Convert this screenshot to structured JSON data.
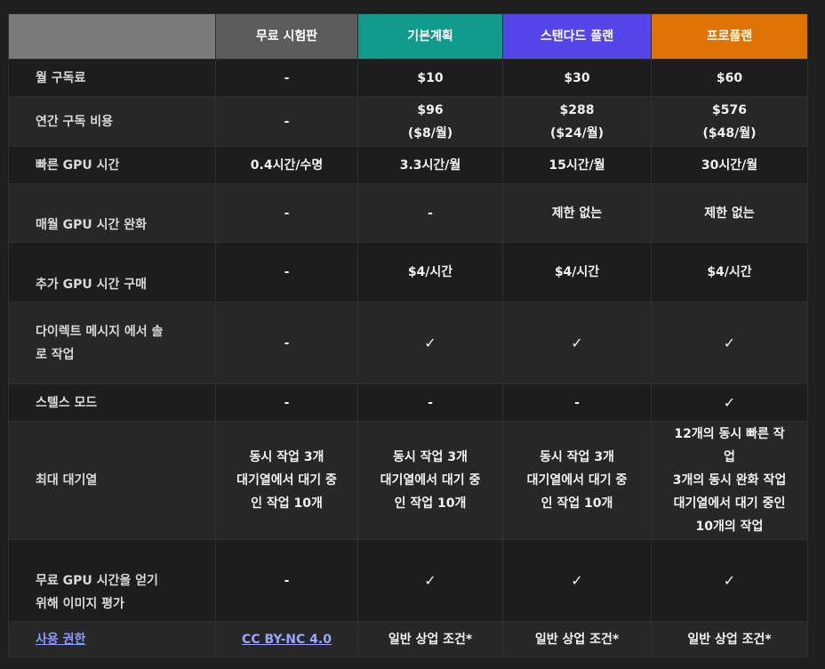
{
  "header": {
    "corner": "",
    "plans": [
      "무료 시험판",
      "기본계획",
      "스탠다드 플랜",
      "프로플랜"
    ]
  },
  "colors": {
    "corner": "#7b7b7b",
    "free": "#5c5c5c",
    "basic": "#0f9a8c",
    "standard": "#5446e8",
    "pro": "#df7405"
  },
  "rows": [
    {
      "label": "월 구독료",
      "cells": [
        "-",
        "$10",
        "$30",
        "$60"
      ]
    },
    {
      "label": "연간 구독 비용",
      "cells": [
        "-",
        "$96\n($8/월)",
        "$288\n($24/월)",
        "$576\n($48/월)"
      ]
    },
    {
      "label": "빠른 GPU 시간",
      "cells": [
        "0.4시간/수명",
        "3.3시간/월",
        "15시간/월",
        "30시간/월"
      ]
    },
    {
      "label": "매월 GPU 시간 완화",
      "cells": [
        "-",
        "-",
        "제한 없는",
        "제한 없는"
      ]
    },
    {
      "label": "추가 GPU 시간 구매",
      "cells": [
        "-",
        "$4/시간",
        "$4/시간",
        "$4/시간"
      ]
    },
    {
      "label": "다이렉트 메시지 에서 솔\n로 작업",
      "cells": [
        "-",
        "✓",
        "✓",
        "✓"
      ]
    },
    {
      "label": "스텔스 모드",
      "cells": [
        "-",
        "-",
        "-",
        "✓"
      ]
    },
    {
      "label": "최대 대기열",
      "cells": [
        "동시 작업 3개\n대기열에서 대기 중\n인 작업 10개",
        "동시 작업 3개\n대기열에서 대기 중\n인 작업 10개",
        "동시 작업 3개\n대기열에서 대기 중\n인 작업 10개",
        "12개의 동시 빠른 작\n업\n3개의 동시 완화 작업\n대기열에서 대기 중인\n10개의 작업"
      ]
    },
    {
      "label": "무료 GPU 시간을 얻기\n위해 이미지 평가",
      "cells": [
        "-",
        "✓",
        "✓",
        "✓"
      ]
    },
    {
      "label": "사용 권한",
      "cells": [
        "CC BY-NC 4.0",
        "일반 상업 조건*",
        "일반 상업 조건*",
        "일반 상업 조건*"
      ]
    }
  ]
}
